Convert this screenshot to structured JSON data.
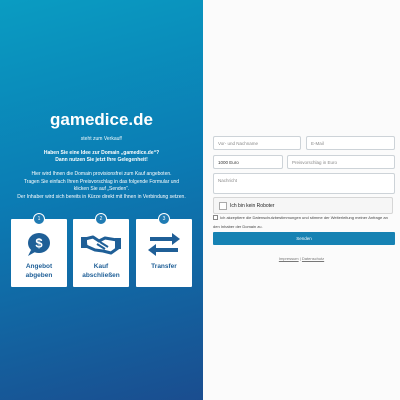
{
  "hero": {
    "domain": "gamedice.de",
    "subtitle": "steht zum Verkauf!",
    "idea_line1": "Haben Sie eine Idee zur Domain „gamedice.de“?",
    "idea_line2": "Dann nutzen Sie jetzt Ihre Gelegenheit!",
    "info_lines": [
      "Hier wird Ihnen die Domain provisionsfrei zum Kauf angeboten.",
      "Tragen Sie einfach Ihren Preisvorschlag in das folgende Formular und",
      "klicken Sie auf „Senden“.",
      "Der Inhaber wird sich bereits in Kürze direkt mit Ihnen in Verbindung setzen."
    ]
  },
  "steps": [
    {
      "num": "1",
      "line1": "Angebot",
      "line2": "abgeben",
      "icon": "dollar-speech-bubble-icon"
    },
    {
      "num": "2",
      "line1": "Kauf",
      "line2": "abschließen",
      "icon": "handshake-icon"
    },
    {
      "num": "3",
      "line1": "Transfer",
      "line2": "",
      "icon": "transfer-arrows-icon"
    }
  ],
  "form": {
    "name_placeholder": "Vor- und Nachname",
    "email_placeholder": "E-Mail",
    "price_value": "1000 Euro",
    "offer_placeholder": "Preisvorschlag in Euro",
    "message_placeholder": "Nachricht",
    "captcha_label": "Ich bin kein Roboter",
    "consent_text": "Ich akzeptiere die Datenschutzbestimmungen und stimme der Weiterleitung meiner Anfrage an den Inhaber der Domain zu.",
    "send_label": "Senden"
  },
  "footer": {
    "imprint": "Impressum",
    "separator": "|",
    "privacy": "Datenschutz"
  },
  "colors": {
    "gradient_top": "#0a9cc2",
    "gradient_bottom": "#1a4d8f",
    "accent": "#1682b3",
    "icon": "#1f5f97"
  }
}
